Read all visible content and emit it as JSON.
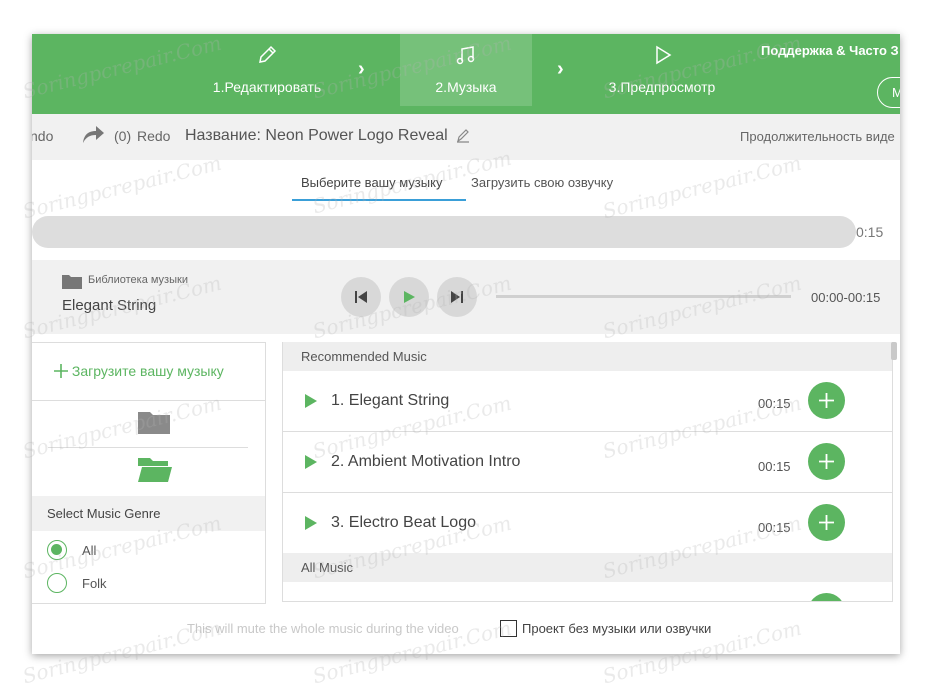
{
  "steps": {
    "items": [
      {
        "label": "1.Редактировать",
        "icon": "pencil-icon"
      },
      {
        "label": "2.Музыка",
        "icon": "music-note-icon",
        "active": true
      },
      {
        "label": "3.Предпросмотр",
        "icon": "play-outline-icon"
      }
    ],
    "chevron": "›",
    "support_label": "Поддержка & Часто З",
    "right_button_label": "М"
  },
  "toolbar": {
    "undo_label": "ndo",
    "redo_count": "(0)",
    "redo_label": "Redo",
    "title": "Название: Neon Power Logo Reveal",
    "duration_label": "Продолжительность виде"
  },
  "music_tabs": {
    "select_label": "Выберите вашу музыку",
    "upload_label": "Загрузить свою озвучку"
  },
  "progress": {
    "time": "0:15",
    "fraction": 1.0
  },
  "player": {
    "library_label": "Библиотека музыки",
    "track_name": "Elegant String",
    "time_range": "00:00-00:15"
  },
  "left_panel": {
    "upload_label": "Загрузите вашу музыку",
    "genre_title": "Select Music Genre",
    "genres": [
      {
        "label": "All",
        "selected": true
      },
      {
        "label": "Folk",
        "selected": false
      }
    ]
  },
  "list": {
    "recommended_header": "Recommended Music",
    "all_header": "All Music",
    "items": [
      {
        "name": "1. Elegant String",
        "time": "00:15"
      },
      {
        "name": "2. Ambient Motivation Intro",
        "time": "00:15"
      },
      {
        "name": "3. Electro Beat Logo",
        "time": "00:15"
      }
    ]
  },
  "footer": {
    "mute_note": "This will mute the whole music during the video",
    "checkbox_label": "Проект без музыки или озвучки",
    "checkbox_checked": false
  },
  "colors": {
    "accent": "#5cb561",
    "accent_active": "#76c17a",
    "tab_underline": "#3a9fd8"
  },
  "watermark": "Soringpcrepair.Com"
}
